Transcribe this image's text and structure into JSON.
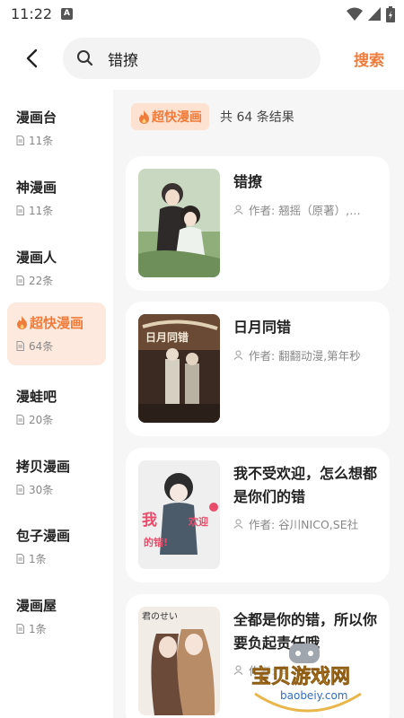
{
  "status_bar": {
    "time": "11:22",
    "notification_letter": "A"
  },
  "header": {
    "search_value": "错撩",
    "search_button": "搜索"
  },
  "sidebar": {
    "items": [
      {
        "name": "漫画台",
        "count": "11条"
      },
      {
        "name": "神漫画",
        "count": "11条"
      },
      {
        "name": "漫画人",
        "count": "22条"
      },
      {
        "name": "超快漫画",
        "count": "64条",
        "active": true
      },
      {
        "name": "漫蛙吧",
        "count": "20条"
      },
      {
        "name": "拷贝漫画",
        "count": "30条"
      },
      {
        "name": "包子漫画",
        "count": "1条"
      },
      {
        "name": "漫画屋",
        "count": "1条"
      }
    ]
  },
  "results": {
    "source_label": "超快漫画",
    "count_text": "共 64 条结果",
    "cards": [
      {
        "title": "错撩",
        "author": "作者: 翘摇（原著）,…"
      },
      {
        "title": "日月同错",
        "author": "作者: 翻翻动漫,第年秒"
      },
      {
        "title": "我不受欢迎，怎么想都是你们的错",
        "author": "作者: 谷川NICO,SE社"
      },
      {
        "title": "全都是你的错，所以你要负起责任哦",
        "author": "作者: 真"
      }
    ]
  },
  "watermark": {
    "text": "宝贝游戏网",
    "url": "baobeiy.com"
  },
  "colors": {
    "accent": "#f07c3b",
    "accent_bg": "#fde9dd"
  }
}
